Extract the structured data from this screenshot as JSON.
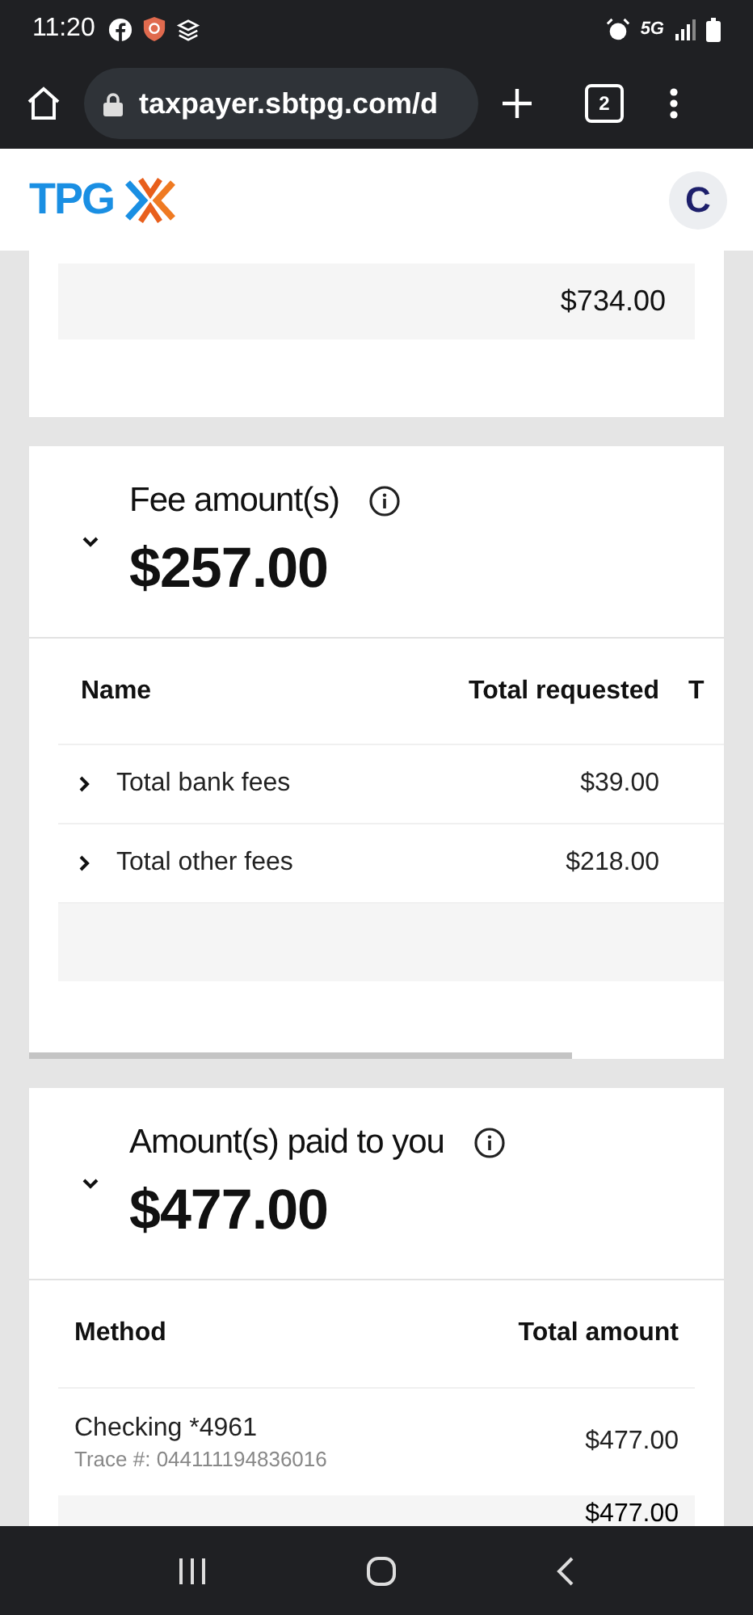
{
  "status_bar": {
    "time": "11:20",
    "network": "5G"
  },
  "browser": {
    "url": "taxpayer.sbtpg.com/d",
    "tab_count": "2"
  },
  "header": {
    "logo": "TPG",
    "avatar": "C"
  },
  "top_card": {
    "total": "$734.00"
  },
  "fee_section": {
    "expanded": true,
    "title": "Fee amount(s)",
    "amount": "$257.00",
    "columns": [
      "Name",
      "Total requested",
      "T"
    ],
    "rows": [
      {
        "name": "Total bank fees",
        "requested": "$39.00",
        "expanded": false
      },
      {
        "name": "Total other fees",
        "requested": "$218.00",
        "expanded": false
      }
    ]
  },
  "paid_section": {
    "expanded": true,
    "title": "Amount(s) paid to you",
    "amount": "$477.00",
    "columns": [
      "Method",
      "Total amount"
    ],
    "rows": [
      {
        "method": "Checking *4961",
        "trace": "Trace #: 044111194836016",
        "amount": "$477.00"
      }
    ],
    "total": "$477.00"
  }
}
